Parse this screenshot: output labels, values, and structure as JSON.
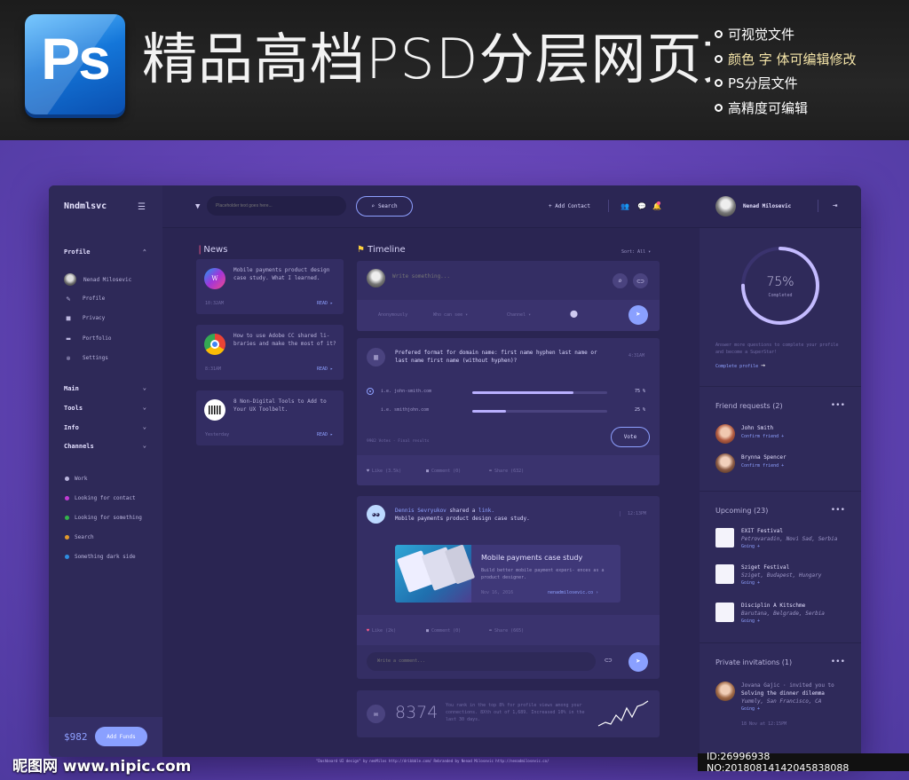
{
  "banner": {
    "logo_text": "Ps",
    "title": "精品高档PSD分层网页文件",
    "features": [
      "可视觉文件",
      "颜色 字 体可编辑修改",
      "PS分层文件",
      "高精度可编辑"
    ]
  },
  "sidebar": {
    "brand": "Nndmlsvc",
    "profile_header": "Profile",
    "profile_items": [
      {
        "label": "Nenad Milosevic",
        "icon": "avatar"
      },
      {
        "label": "Profile",
        "icon": "pencil-icon"
      },
      {
        "label": "Privacy",
        "icon": "lock-icon"
      },
      {
        "label": "Portfolio",
        "icon": "folder-icon"
      },
      {
        "label": "Settings",
        "icon": "gear-icon"
      }
    ],
    "sections": [
      "Main",
      "Tools",
      "Info",
      "Channels"
    ],
    "channels": [
      {
        "label": "Work",
        "color": "#b9b4dc"
      },
      {
        "label": "Looking for contact",
        "color": "#c23bd4"
      },
      {
        "label": "Looking for something",
        "color": "#33b34a"
      },
      {
        "label": "Search",
        "color": "#e39a2b"
      },
      {
        "label": "Something dark side",
        "color": "#2f8de0"
      }
    ],
    "funds_amount": "$982",
    "funds_button": "Add Funds"
  },
  "topbar": {
    "search_placeholder": "Placeholder text goes here...",
    "search_button": "Search",
    "add_contact": "+ Add Contact",
    "user_name": "Nenad Milosevic"
  },
  "news": {
    "title": "News",
    "items": [
      {
        "text": "Mobile payments product design case study. What I learned.",
        "time": "10:32AM",
        "read": "READ ▸"
      },
      {
        "text": "How to use Adobe CC shared li- braries and make the most of it?",
        "time": "8:31AM",
        "read": "READ ▸"
      },
      {
        "text": "8 Non-Digital Tools to Add to Your UX Toolbelt.",
        "time": "Yesterday",
        "read": "READ ▸"
      }
    ]
  },
  "timeline": {
    "title": "Timeline",
    "sort": "Sort: All ▾",
    "composer_placeholder": "Write something...",
    "composer_options": [
      "Anonymously",
      "Who can see ▾",
      "Channel ▾"
    ],
    "poll": {
      "question": "Prefered format for domain name: first name hyphen last name or last name first name (without hyphen)?",
      "time": "4:31AM",
      "options": [
        {
          "label": "i.e. john-smith.com",
          "percent": 75,
          "percent_label": "75 %"
        },
        {
          "label": "i.e. smithjohn.com",
          "percent": 25,
          "percent_label": "25 %"
        }
      ],
      "meta": "9902 Votes · Final results",
      "vote_button": "Vote",
      "like": "Like (3.5k)",
      "comment": "Comment (0)",
      "share": "Share (632)"
    },
    "share_post": {
      "author": "Dennis Sevryukov",
      "action": "shared a",
      "link_word": "link.",
      "text": "Mobile payments product design case study.",
      "time": "12:13PM",
      "article_title": "Mobile payments case study",
      "article_desc": "Build better mobile payment experi- ences as a product designer.",
      "article_date": "Nov 16, 2016",
      "article_link": "nenadmilosevic.co ›",
      "like": "Like (2k)",
      "comment": "Comment (0)",
      "share": "Share (665)",
      "comment_placeholder": "Write a comment..."
    },
    "rank": {
      "number": "8374",
      "text": "You rank in the top 8% for profile views among your connections. 8Xth out of 1,689. Increased 10% in the last 30 days."
    }
  },
  "right_panel": {
    "progress_percent": 75,
    "progress_label": "75%",
    "progress_sub": "Completed",
    "progress_text": "Answer more questions to complete your profile and become a SuperStar!",
    "complete_link": "Complete profile",
    "friend_requests": {
      "title": "Friend requests",
      "count": "(2)",
      "items": [
        {
          "name": "John Smith",
          "action": "Confirm friend +"
        },
        {
          "name": "Brynna Spencer",
          "action": "Confirm friend +"
        }
      ]
    },
    "upcoming": {
      "title": "Upcoming",
      "count": "(23)",
      "items": [
        {
          "name": "EXIT Festival",
          "place": "Petrovaradin, Novi Sad, Serbia",
          "action": "Going +"
        },
        {
          "name": "Sziget Festival",
          "place": "Sziget, Budapest, Hungary",
          "action": "Going +"
        },
        {
          "name": "Disciplin A Kitschme",
          "place": "Barutana, Belgrade, Serbia",
          "action": "Going +"
        }
      ]
    },
    "invitations": {
      "title": "Private invitations",
      "count": "(1)",
      "name": "Jovana Gajic",
      "invite": "· invited you to",
      "event": "Solving the dinner dilemma",
      "place": "Yummly, San Francisco, CA",
      "action": "Going +",
      "date": "18 Nov at 12:15PM"
    }
  },
  "footer_credit": "\"Dashboard UI design\" by nenMilos http://dribbble.com/ Rebranded by Nenad Milosevic http://nenadmilosevic.co/",
  "watermark": "昵图网 www.nipic.com",
  "idtag": "ID:26996938 NO:20180814142045838088"
}
